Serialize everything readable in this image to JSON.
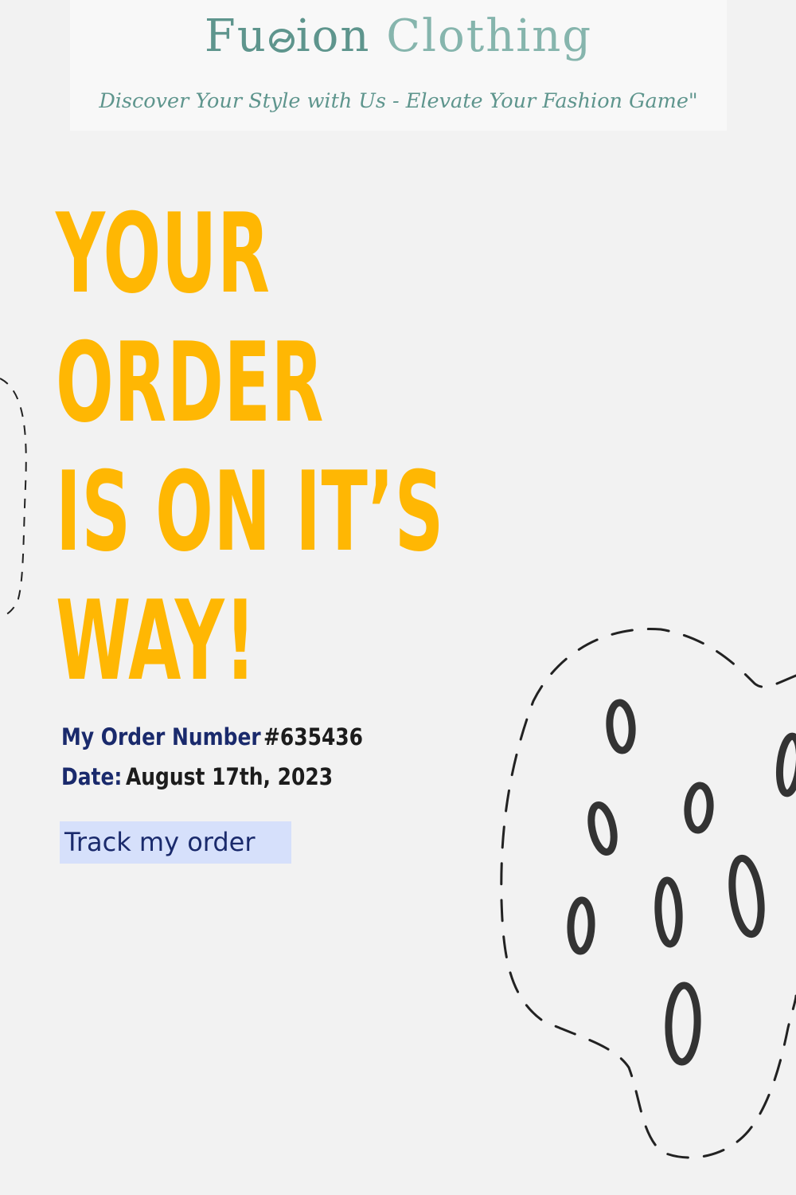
{
  "header": {
    "brand_part1": "Fu",
    "brand_part2": "ion ",
    "brand_part3": "Clothing",
    "tagline": "Discover Your Style with Us - Elevate Your Fashion Game\""
  },
  "headline": {
    "lines": [
      "YOUR",
      "ORDER",
      "IS ON IT’S",
      "WAY!"
    ]
  },
  "order": {
    "number_label": "My Order Number",
    "number_value": " #635436",
    "date_label": "Date:",
    "date_value": " August  17th, 2023"
  },
  "track_button": {
    "label": "Track my order"
  },
  "colors": {
    "background": "#f2f2f2",
    "brand_teal": "#5e958d",
    "headline_yellow": "#ffb703",
    "navy": "#1a2a6c",
    "button_bg": "#d6e0fb"
  },
  "icons": {
    "brand_logo": "swirl-logo-icon",
    "decoration": "dotted-blob-decoration"
  }
}
